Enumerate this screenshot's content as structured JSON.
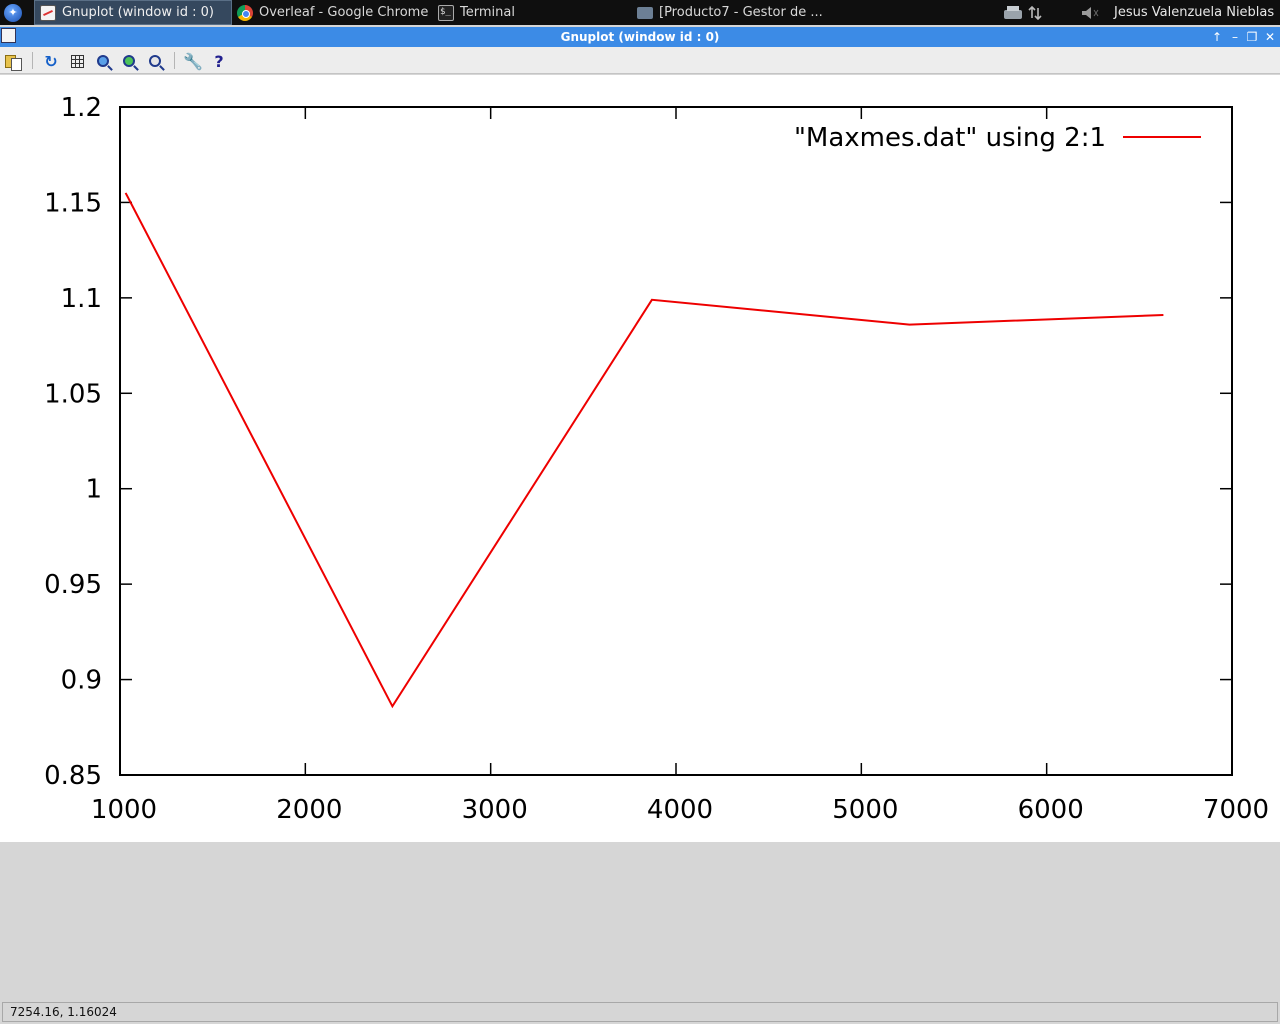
{
  "taskbar": {
    "start_icon": "app-menu-icon",
    "items": [
      {
        "label": "Gnuplot (window id : 0)",
        "icon": "gnuplot-icon"
      },
      {
        "label": "Overleaf - Google Chrome",
        "icon": "chrome-icon"
      },
      {
        "label": "Terminal",
        "icon": "terminal-icon"
      },
      {
        "label": "[Producto7 - Gestor de ...",
        "icon": "folder-icon"
      }
    ],
    "user": "Jesus Valenzuela Nieblas"
  },
  "window": {
    "title": "Gnuplot (window id : 0)"
  },
  "toolbar": {
    "tools": [
      "copy-icon",
      "replot-icon",
      "grid-icon",
      "zoom-prev-icon",
      "zoom-next-icon",
      "unzoom-icon",
      "settings-icon",
      "help-icon"
    ]
  },
  "chart_data": {
    "type": "line",
    "title": "",
    "xlabel": "",
    "ylabel": "",
    "xlim": [
      1000,
      7000
    ],
    "ylim": [
      0.85,
      1.2
    ],
    "xticks": [
      "1000",
      "2000",
      "3000",
      "4000",
      "5000",
      "6000",
      "7000"
    ],
    "yticks": [
      "0.85",
      "0.9",
      "0.95",
      "1",
      "1.05",
      "1.1",
      "1.15",
      "1.2"
    ],
    "legend_position": "top-right",
    "series": [
      {
        "name": "\"Maxmes.dat\" using 2:1",
        "color": "#ee0000",
        "x": [
          1030,
          2470,
          3870,
          5260,
          6630
        ],
        "y": [
          1.155,
          0.886,
          1.099,
          1.086,
          1.091
        ]
      }
    ]
  },
  "statusbar": {
    "coordinates": "7254.16,  1.16024"
  }
}
